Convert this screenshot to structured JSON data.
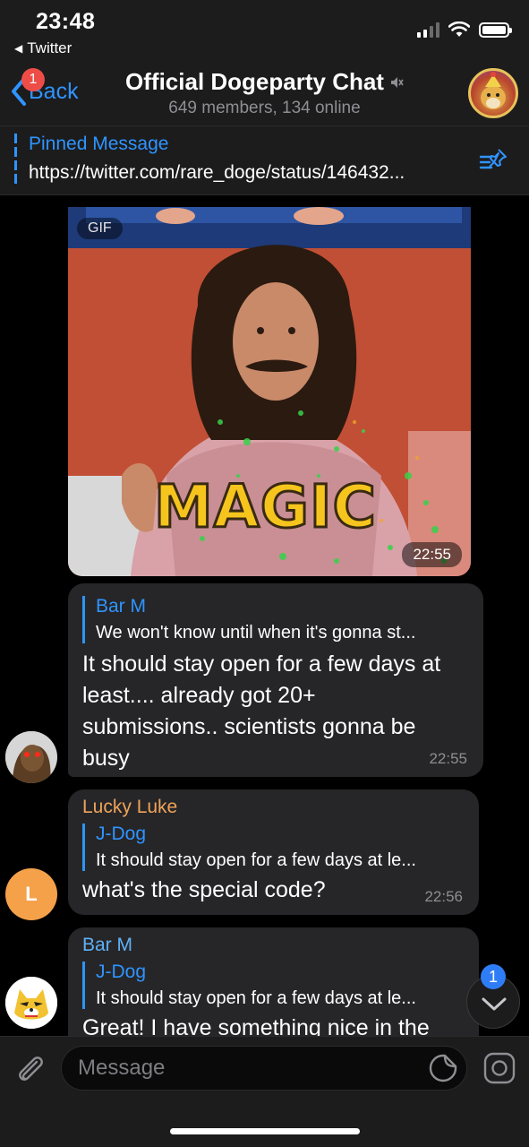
{
  "status_bar": {
    "time": "23:48",
    "return_app": "Twitter"
  },
  "header": {
    "back_label": "Back",
    "unread_count": "1",
    "title": "Official Dogeparty Chat",
    "subtitle": "649 members, 134 online"
  },
  "pinned": {
    "title": "Pinned Message",
    "text": "https://twitter.com/rare_doge/status/146432..."
  },
  "messages": [
    {
      "type": "gif",
      "label": "GIF",
      "caption_text": "MAGIC",
      "time": "22:55"
    },
    {
      "reply_name": "Bar M",
      "reply_text": "We won't know until when it's gonna st...",
      "text": "It should stay open for a few days at least.... already got 20+ submissions.. scientists gonna be busy",
      "time": "22:55"
    },
    {
      "sender": "Lucky Luke",
      "sender_color": "#f0a35a",
      "reply_name": "J-Dog",
      "reply_text": "It should stay open for a few days at le...",
      "text": "what's the special code?",
      "time": "22:56",
      "avatar_letter": "L"
    },
    {
      "sender": "Bar M",
      "sender_color": "#5fb1f5",
      "reply_name": "J-Dog",
      "reply_text": "It should stay open for a few days at le...",
      "text": "Great! I have something nice in the"
    }
  ],
  "scroll_down": {
    "badge": "1"
  },
  "composer": {
    "placeholder": "Message"
  },
  "colors": {
    "accent": "#2f94ff",
    "bubble": "#262628",
    "bar": "#1c1c1d",
    "badge_red": "#ee4d47"
  },
  "icons": [
    "back-chevron-icon",
    "mute-icon",
    "pin-list-icon",
    "attach-icon",
    "sticker-icon",
    "camera-icon",
    "chevron-down-icon"
  ]
}
